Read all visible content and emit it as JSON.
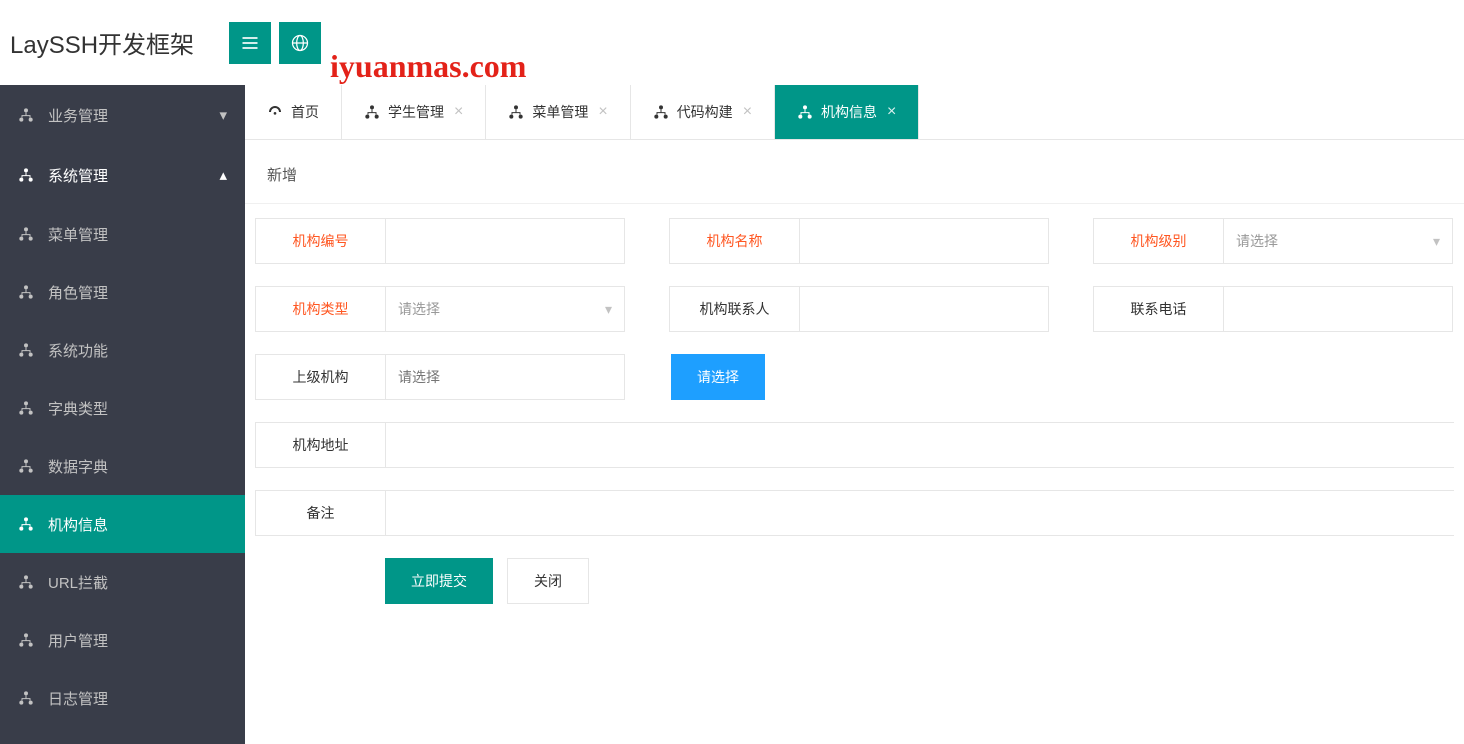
{
  "header": {
    "app_title": "LaySSH开发框架",
    "watermark": "iyuanmas.com"
  },
  "sidebar": {
    "groups": [
      {
        "label": "业务管理",
        "open": false
      },
      {
        "label": "系统管理",
        "open": true
      }
    ],
    "sys_items": [
      {
        "label": "菜单管理"
      },
      {
        "label": "角色管理"
      },
      {
        "label": "系统功能"
      },
      {
        "label": "字典类型"
      },
      {
        "label": "数据字典"
      },
      {
        "label": "机构信息",
        "active": true
      },
      {
        "label": "URL拦截"
      },
      {
        "label": "用户管理"
      },
      {
        "label": "日志管理"
      }
    ]
  },
  "tabs": [
    {
      "label": "首页",
      "closable": false
    },
    {
      "label": "学生管理",
      "closable": true
    },
    {
      "label": "菜单管理",
      "closable": true
    },
    {
      "label": "代码构建",
      "closable": true
    },
    {
      "label": "机构信息",
      "closable": true,
      "active": true
    }
  ],
  "page": {
    "title": "新增",
    "labels": {
      "org_code": "机构编号",
      "org_name": "机构名称",
      "org_level": "机构级别",
      "org_type": "机构类型",
      "org_contact": "机构联系人",
      "contact_phone": "联系电话",
      "parent_org": "上级机构",
      "org_address": "机构地址",
      "remark": "备注"
    },
    "placeholders": {
      "please_select": "请选择"
    },
    "buttons": {
      "select": "请选择",
      "submit": "立即提交",
      "close": "关闭"
    }
  },
  "colors": {
    "accent": "#009688",
    "danger": "#ff5722",
    "blue": "#1e9fff"
  }
}
